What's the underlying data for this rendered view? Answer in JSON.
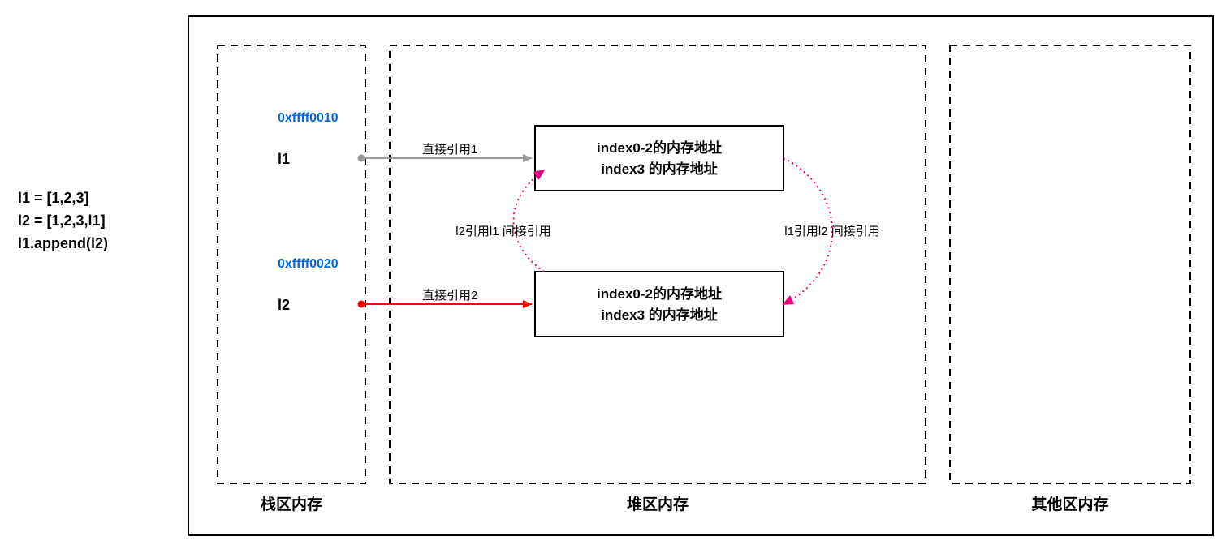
{
  "code": {
    "line1": "l1 = [1,2,3]",
    "line2": "l2 = [1,2,3,l1]",
    "line3": "l1.append(l2)"
  },
  "stack": {
    "addr1": "0xffff0010",
    "var1": "l1",
    "addr2": "0xffff0020",
    "var2": "l2",
    "label": "栈区内存"
  },
  "heap": {
    "box1_line1": "index0-2的内存地址",
    "box1_line2": "index3 的内存地址",
    "box2_line1": "index0-2的内存地址",
    "box2_line2": "index3 的内存地址",
    "direct1": "直接引用1",
    "direct2": "直接引用2",
    "indirect_left": "l2引用l1 间接引用",
    "indirect_right": "l1引用l2 间接引用",
    "label": "堆区内存"
  },
  "other": {
    "label": "其他区内存"
  },
  "colors": {
    "gray_arrow": "#9b9b9b",
    "red_arrow": "#ff0000",
    "magenta": "#e6007e",
    "magenta_fill": "#e6007e",
    "addr_blue": "#0066d6"
  }
}
